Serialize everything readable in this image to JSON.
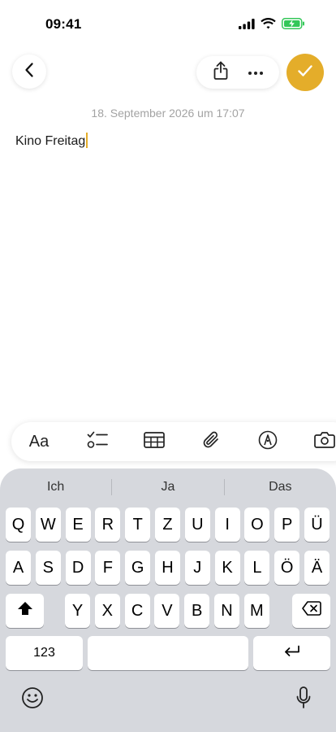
{
  "status": {
    "time": "09:41",
    "icons": [
      "cellular-signal-icon",
      "wifi-icon",
      "battery-charging-icon"
    ],
    "battery_color": "#34c759"
  },
  "nav": {
    "back_icon": "chevron-left-icon",
    "share_icon": "share-icon",
    "more_icon": "ellipsis-icon",
    "done_icon": "checkmark-icon",
    "accent_color": "#e4ad2a"
  },
  "note": {
    "date": "18. September 2026 um 17:07",
    "body": "Kino Freitag",
    "caret_color": "#e4ad2a"
  },
  "toolbar": {
    "format_label": "Aa",
    "items": [
      "format-text",
      "checklist-icon",
      "table-icon",
      "paperclip-icon",
      "markup-pen-icon",
      "camera-icon"
    ]
  },
  "keyboard": {
    "suggestions": [
      "Ich",
      "Ja",
      "Das"
    ],
    "row1": [
      "Q",
      "W",
      "E",
      "R",
      "T",
      "Z",
      "U",
      "I",
      "O",
      "P",
      "Ü"
    ],
    "row2": [
      "A",
      "S",
      "D",
      "F",
      "G",
      "H",
      "J",
      "K",
      "L",
      "Ö",
      "Ä"
    ],
    "row3": [
      "Y",
      "X",
      "C",
      "V",
      "B",
      "N",
      "M"
    ],
    "numbers_label": "123",
    "shift_icon": "shift-icon",
    "delete_icon": "delete-backspace-icon",
    "return_icon": "return-icon",
    "emoji_icon": "emoji-icon",
    "mic_icon": "microphone-icon"
  }
}
